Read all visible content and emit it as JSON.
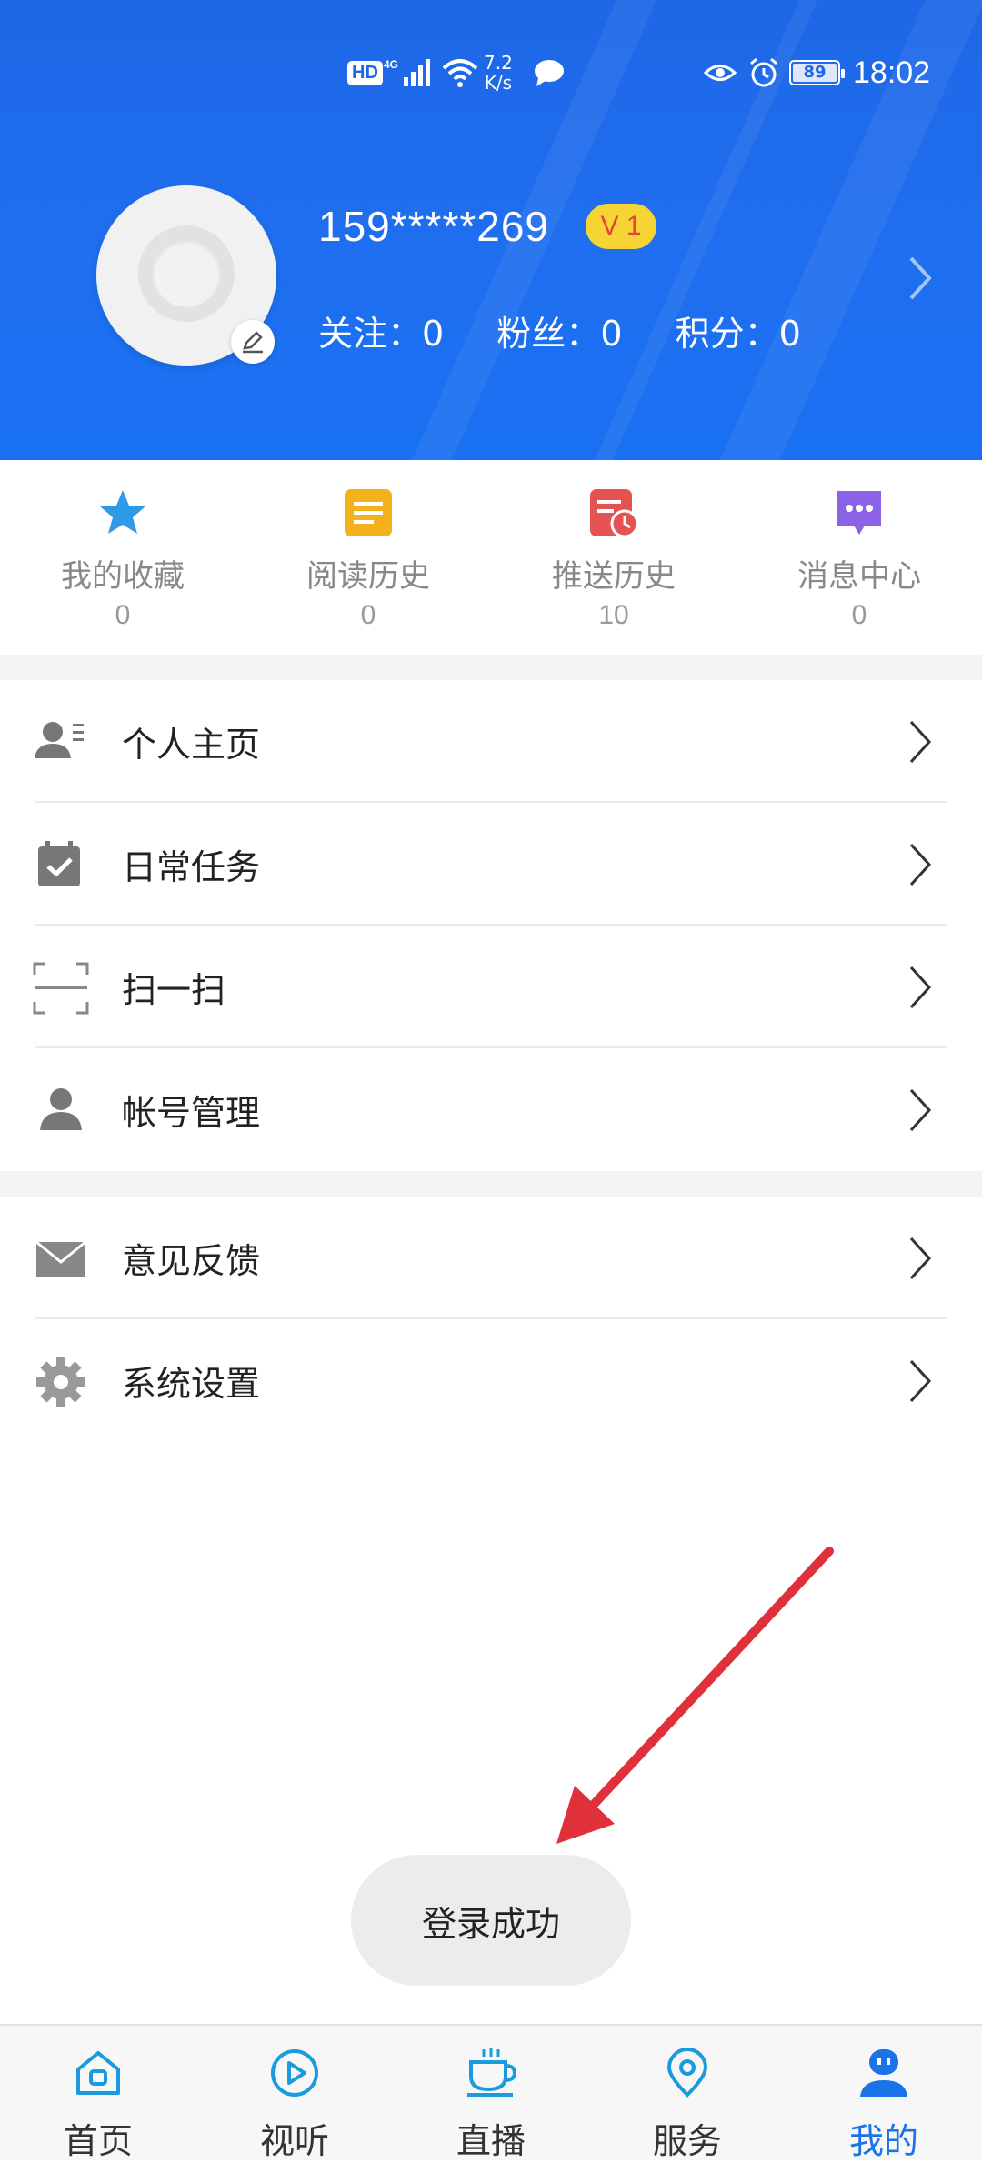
{
  "status_bar": {
    "hd": "HD",
    "network": "4G",
    "speed_value": "7.2",
    "speed_unit": "K/s",
    "battery": "89",
    "time": "18:02"
  },
  "profile": {
    "username": "159*****269",
    "level": "V 1",
    "stats": [
      {
        "label": "关注：",
        "value": "0"
      },
      {
        "label": "粉丝：",
        "value": "0"
      },
      {
        "label": "积分：",
        "value": "0"
      }
    ]
  },
  "quick_actions": [
    {
      "label": "我的收藏",
      "count": "0",
      "icon": "star-icon",
      "color": "#2f9be8"
    },
    {
      "label": "阅读历史",
      "count": "0",
      "icon": "document-icon",
      "color": "#f2b21c"
    },
    {
      "label": "推送历史",
      "count": "10",
      "icon": "history-icon",
      "color": "#e45252"
    },
    {
      "label": "消息中心",
      "count": "0",
      "icon": "message-icon",
      "color": "#8c63e6"
    }
  ],
  "menu_group_1": [
    {
      "label": "个人主页",
      "icon": "profile-card-icon"
    },
    {
      "label": "日常任务",
      "icon": "calendar-check-icon"
    },
    {
      "label": "扫一扫",
      "icon": "scan-icon"
    },
    {
      "label": "帐号管理",
      "icon": "user-icon"
    }
  ],
  "menu_group_2": [
    {
      "label": "意见反馈",
      "icon": "mail-icon"
    },
    {
      "label": "系统设置",
      "icon": "gear-icon"
    }
  ],
  "toast": {
    "text": "登录成功"
  },
  "tabbar": [
    {
      "label": "首页",
      "icon": "home-icon"
    },
    {
      "label": "视听",
      "icon": "play-icon"
    },
    {
      "label": "直播",
      "icon": "cup-icon"
    },
    {
      "label": "服务",
      "icon": "location-pin-icon"
    },
    {
      "label": "我的",
      "icon": "profile-icon",
      "active": true
    }
  ],
  "colors": {
    "header_blue": "#1e67e6",
    "active_tab": "#1a73e8",
    "level_badge": "#f5d433",
    "annotation_arrow": "#e0303a"
  }
}
